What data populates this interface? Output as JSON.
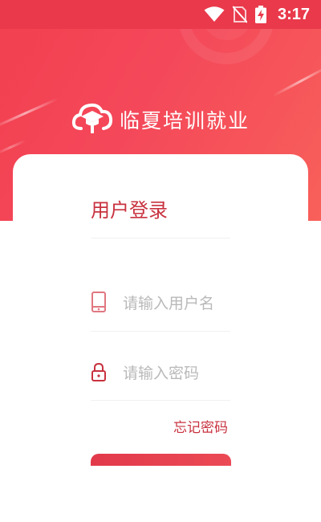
{
  "status_bar": {
    "time": "3:17",
    "icons": [
      "wifi-icon",
      "no-sim-icon",
      "battery-charging-icon"
    ]
  },
  "brand": {
    "logo_icon": "cloud-graduation-cap-icon",
    "name": "临夏培训就业"
  },
  "login": {
    "title": "用户登录",
    "username": {
      "icon": "phone-icon",
      "placeholder": "请输入用户名",
      "value": ""
    },
    "password": {
      "icon": "lock-icon",
      "placeholder": "请输入密码",
      "value": ""
    },
    "forgot_password": "忘记密码",
    "login_button_label": ""
  },
  "colors": {
    "accent": "#c8323f",
    "header_gradient_start": "#f2404f",
    "header_gradient_end": "#f8605a",
    "status_bar": "#e9394b"
  }
}
